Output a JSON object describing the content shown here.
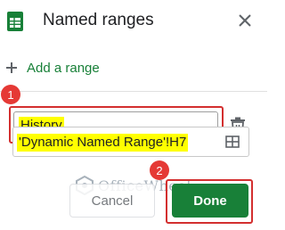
{
  "header": {
    "title": "Named ranges",
    "app_icon": "google-sheets-icon",
    "close_icon": "close-icon"
  },
  "add_range": {
    "label": "Add a range",
    "icon": "plus-icon"
  },
  "range_item": {
    "name_value": "History",
    "range_value": "'Dynamic Named Range'!H7",
    "delete_icon": "trash-icon",
    "range_picker_icon": "grid-icon"
  },
  "annotations": {
    "step1": "1",
    "step2": "2"
  },
  "watermark": {
    "text": "OfficeWheel"
  },
  "actions": {
    "cancel_label": "Cancel",
    "done_label": "Done"
  },
  "colors": {
    "accent_green": "#188038",
    "highlight": "#ffff00",
    "annotation_red": "#d32f2f"
  }
}
